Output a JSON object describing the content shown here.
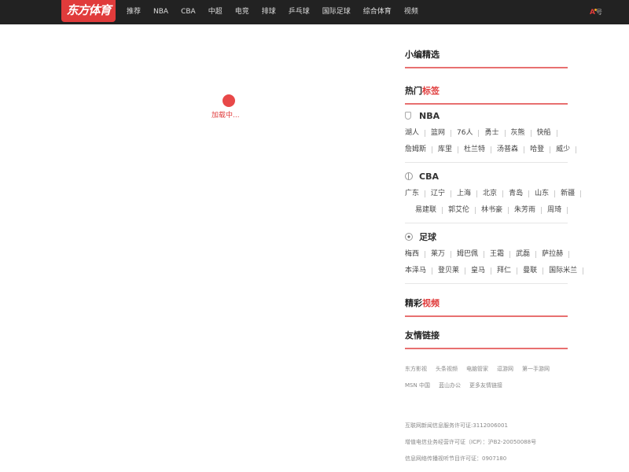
{
  "header": {
    "logo_text": "东方体育",
    "nav": [
      "推荐",
      "NBA",
      "CBA",
      "中超",
      "电竞",
      "排球",
      "乒乓球",
      "国际足球",
      "综合体育",
      "视频"
    ],
    "account_label": "号"
  },
  "loader": {
    "text": "加载中..."
  },
  "sidebar": {
    "editor_pick": "小编精选",
    "hot_tags": {
      "title_a": "热门",
      "title_b": "标签"
    },
    "categories": [
      {
        "name": "NBA",
        "icon": "trophy-icon",
        "rows": [
          [
            "湖人",
            "篮网",
            "76人",
            "勇士",
            "灰熊",
            "快船"
          ],
          [
            "詹姆斯",
            "库里",
            "杜兰特",
            "汤普森",
            "哈登",
            "威少"
          ]
        ]
      },
      {
        "name": "CBA",
        "icon": "basketball-icon",
        "rows": [
          [
            "广东",
            "辽宁",
            "上海",
            "北京",
            "青岛",
            "山东",
            "新疆"
          ],
          [
            "易建联",
            "郭艾伦",
            "林书豪",
            "朱芳雨",
            "周琦"
          ]
        ]
      },
      {
        "name": "足球",
        "icon": "soccer-ball-icon",
        "rows": [
          [
            "梅西",
            "莱万",
            "姆巴佩",
            "王霜",
            "武磊",
            "萨拉赫"
          ],
          [
            "本泽马",
            "登贝莱",
            "皇马",
            "拜仁",
            "曼联",
            "国际米兰"
          ]
        ]
      }
    ],
    "video": {
      "title_a": "精彩",
      "title_b": "视频"
    },
    "friend_links": {
      "title": "友情链接",
      "rows": [
        [
          "东方影视",
          "头条视频",
          "电脑管家",
          "逗游网",
          "第一手游网"
        ],
        [
          "MSN 中国",
          "蓝山办公",
          "更多友情链接"
        ]
      ]
    },
    "licenses": [
      "互联网新闻信息服务许可证:3112006001",
      "增值电信业务经营许可证（ICP）：沪B2-20050088号",
      "信息网络传播视听节目许可证：0907180"
    ]
  },
  "colors": {
    "accent": "#e03b3b",
    "topbar": "#222222"
  }
}
